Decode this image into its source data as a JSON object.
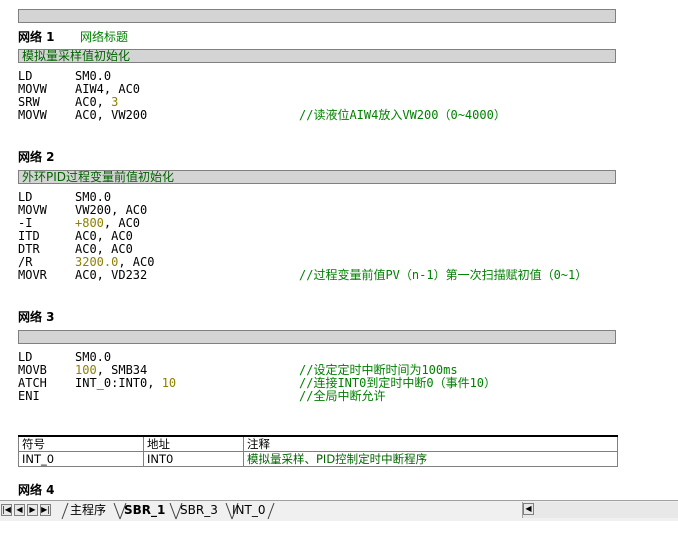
{
  "networks": [
    {
      "label": "网络 1",
      "title": "网络标题",
      "comment": "模拟量采样值初始化",
      "lines": [
        {
          "op": "LD",
          "args": [
            {
              "t": "SM0.0"
            }
          ],
          "comment": ""
        },
        {
          "op": "MOVW",
          "args": [
            {
              "t": "AIW4, AC0"
            }
          ],
          "comment": ""
        },
        {
          "op": "SRW",
          "args": [
            {
              "t": "AC0, "
            },
            {
              "t": "3",
              "c": true
            }
          ],
          "comment": ""
        },
        {
          "op": "MOVW",
          "args": [
            {
              "t": "AC0, VW200"
            }
          ],
          "comment": "//读液位AIW4放入VW200（0~4000）"
        }
      ]
    },
    {
      "label": "网络 2",
      "title": "",
      "comment": "外环PID过程变量前值初始化",
      "lines": [
        {
          "op": "LD",
          "args": [
            {
              "t": "SM0.0"
            }
          ],
          "comment": ""
        },
        {
          "op": "MOVW",
          "args": [
            {
              "t": "VW200, AC0"
            }
          ],
          "comment": ""
        },
        {
          "op": "-I",
          "args": [
            {
              "t": "+800",
              "c": true
            },
            {
              "t": ", AC0"
            }
          ],
          "comment": ""
        },
        {
          "op": "ITD",
          "args": [
            {
              "t": "AC0, AC0"
            }
          ],
          "comment": ""
        },
        {
          "op": "DTR",
          "args": [
            {
              "t": "AC0, AC0"
            }
          ],
          "comment": ""
        },
        {
          "op": "/R",
          "args": [
            {
              "t": "3200.0",
              "c": true
            },
            {
              "t": ", AC0"
            }
          ],
          "comment": ""
        },
        {
          "op": "MOVR",
          "args": [
            {
              "t": "AC0, VD232"
            }
          ],
          "comment": "//过程变量前值PV（n-1）第一次扫描赋初值（0~1）"
        }
      ]
    },
    {
      "label": "网络 3",
      "title": "",
      "comment": "",
      "lines": [
        {
          "op": "LD",
          "args": [
            {
              "t": "SM0.0"
            }
          ],
          "comment": ""
        },
        {
          "op": "MOVB",
          "args": [
            {
              "t": "100",
              "c": true
            },
            {
              "t": ", SMB34"
            }
          ],
          "comment": "//设定定时中断时间为100ms"
        },
        {
          "op": "ATCH",
          "args": [
            {
              "t": "INT_0:INT0, "
            },
            {
              "t": "10",
              "c": true
            }
          ],
          "comment": "//连接INT0到定时中断0（事件10）"
        },
        {
          "op": "ENI",
          "args": [],
          "comment": "//全局中断允许"
        }
      ]
    }
  ],
  "symbol_table": {
    "headers": [
      "符号",
      "地址",
      "注释"
    ],
    "rows": [
      [
        "INT_0",
        "INT0",
        "模拟量采样、PID控制定时中断程序"
      ]
    ]
  },
  "network4_label": "网络 4",
  "tabs": [
    "主程序",
    "SBR_1",
    "SBR_3",
    "INT_0"
  ],
  "active_tab": "SBR_1"
}
